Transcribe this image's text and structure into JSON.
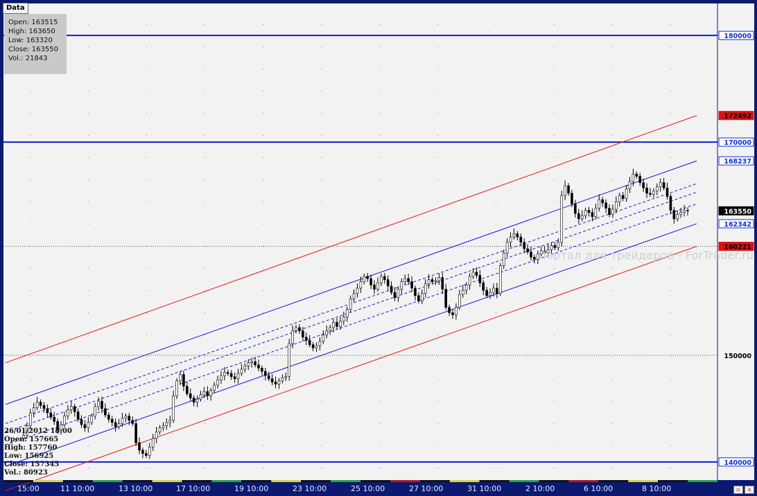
{
  "header": {
    "data_tab_label": "Data"
  },
  "info_box": {
    "open": "Open: 163515",
    "high": "High: 163650",
    "low": "Low: 163320",
    "close": "Close: 163550",
    "vol": "Vol.: 21843"
  },
  "crosshair_readout": {
    "datetime": "26/01/2012 18:00",
    "open": "Open: 157665",
    "high": "High: 157760",
    "low": "Low: 156925",
    "close": "Close: 157345",
    "vol": "Vol.: 80923"
  },
  "watermark": "Портал для трейдеров - ForTrader.ru",
  "colors": {
    "background": "#f2f2f2",
    "frame": "#0b1a70",
    "blue_line": "#0d1bd6",
    "red_line": "#e01818",
    "candle": "#000000",
    "label_blue": "#1133cc",
    "label_red": "#dd1111",
    "label_black": "#000000"
  },
  "chart_data": {
    "type": "candlestick",
    "y_range": [
      138300,
      183000
    ],
    "x_ticks": [
      "15:00",
      "11 10:00",
      "13 10:00",
      "17 10:00",
      "19 10:00",
      "23 10:00",
      "25 10:00",
      "27 10:00",
      "31 10:00",
      "2 10:00",
      "6 10:00",
      "8 10:00"
    ],
    "horizontal_levels": [
      {
        "value": 180000,
        "label": "180000",
        "style": "blue"
      },
      {
        "value": 170000,
        "label": "170000",
        "style": "blue"
      },
      {
        "value": 160221,
        "label": "160221",
        "style": "red-dotted"
      },
      {
        "value": 150000,
        "label": "150000",
        "style": "dotted"
      },
      {
        "value": 140000,
        "label": "140000",
        "style": "blue"
      }
    ],
    "price_labels": [
      {
        "value": 172492,
        "label": "172492",
        "color": "red"
      },
      {
        "value": 168237,
        "label": "168237",
        "color": "blue"
      },
      {
        "value": 163550,
        "label": "163550",
        "color": "black"
      },
      {
        "value": 162342,
        "label": "162342",
        "color": "blue"
      }
    ],
    "channels": [
      {
        "name": "outer-upper",
        "color": "red",
        "dashed": false,
        "start": 149300,
        "end": 172492
      },
      {
        "name": "outer-lower",
        "color": "red",
        "dashed": false,
        "start": 137300,
        "end": 160221
      },
      {
        "name": "inner-upper",
        "color": "blue",
        "dashed": false,
        "start": 145400,
        "end": 168237
      },
      {
        "name": "inner-lower",
        "color": "blue",
        "dashed": false,
        "start": 139600,
        "end": 162342
      },
      {
        "name": "mid-1",
        "color": "blue",
        "dashed": true,
        "start": 143600,
        "end": 166100
      },
      {
        "name": "mid-2",
        "color": "blue",
        "dashed": true,
        "start": 142800,
        "end": 165300
      },
      {
        "name": "mid-3",
        "color": "blue",
        "dashed": true,
        "start": 141600,
        "end": 164200
      }
    ],
    "closes": [
      142500,
      143400,
      144600,
      145100,
      145600,
      145300,
      145000,
      144600,
      144200,
      143800,
      143000,
      143500,
      144300,
      144900,
      145200,
      144700,
      144000,
      143500,
      143200,
      143700,
      144300,
      145200,
      145700,
      145000,
      144400,
      144000,
      143700,
      143300,
      143600,
      144100,
      144300,
      143900,
      143600,
      141800,
      141100,
      140800,
      140600,
      141400,
      142200,
      142800,
      143200,
      143400,
      143700,
      143900,
      146200,
      147600,
      148200,
      147100,
      146400,
      146000,
      145600,
      145900,
      146300,
      146600,
      146200,
      146700,
      147200,
      147700,
      148100,
      148400,
      148300,
      148000,
      147800,
      148300,
      148700,
      149000,
      149300,
      149400,
      149100,
      148800,
      148500,
      148100,
      147800,
      147500,
      147300,
      147600,
      147900,
      148000,
      151100,
      152300,
      152600,
      152300,
      151700,
      151400,
      151000,
      150700,
      150900,
      151300,
      151900,
      152300,
      152600,
      153100,
      152700,
      153200,
      153600,
      154300,
      155300,
      155800,
      156300,
      156900,
      157400,
      157200,
      156600,
      156200,
      156800,
      157400,
      157100,
      156500,
      155900,
      155400,
      156200,
      156900,
      157200,
      156900,
      156300,
      155600,
      155100,
      155800,
      156700,
      157100,
      156900,
      157000,
      157300,
      156200,
      154500,
      154000,
      153800,
      154500,
      155700,
      156100,
      156600,
      157400,
      157800,
      157500,
      156800,
      156100,
      155600,
      155900,
      156300,
      155800,
      158400,
      159600,
      160600,
      161100,
      161400,
      161100,
      160600,
      160000,
      159700,
      159200,
      159000,
      159500,
      159800,
      159600,
      159900,
      160300,
      160100,
      160600,
      165000,
      165900,
      165200,
      164200,
      163300,
      162800,
      163100,
      163600,
      163400,
      163000,
      163800,
      164600,
      164300,
      163800,
      163200,
      163700,
      164400,
      165000,
      164700,
      165600,
      166300,
      167000,
      166800,
      166200,
      165700,
      165200,
      165100,
      165400,
      165800,
      166200,
      165700,
      164900,
      163600,
      162800,
      163200,
      163400,
      163600,
      163550
    ]
  }
}
